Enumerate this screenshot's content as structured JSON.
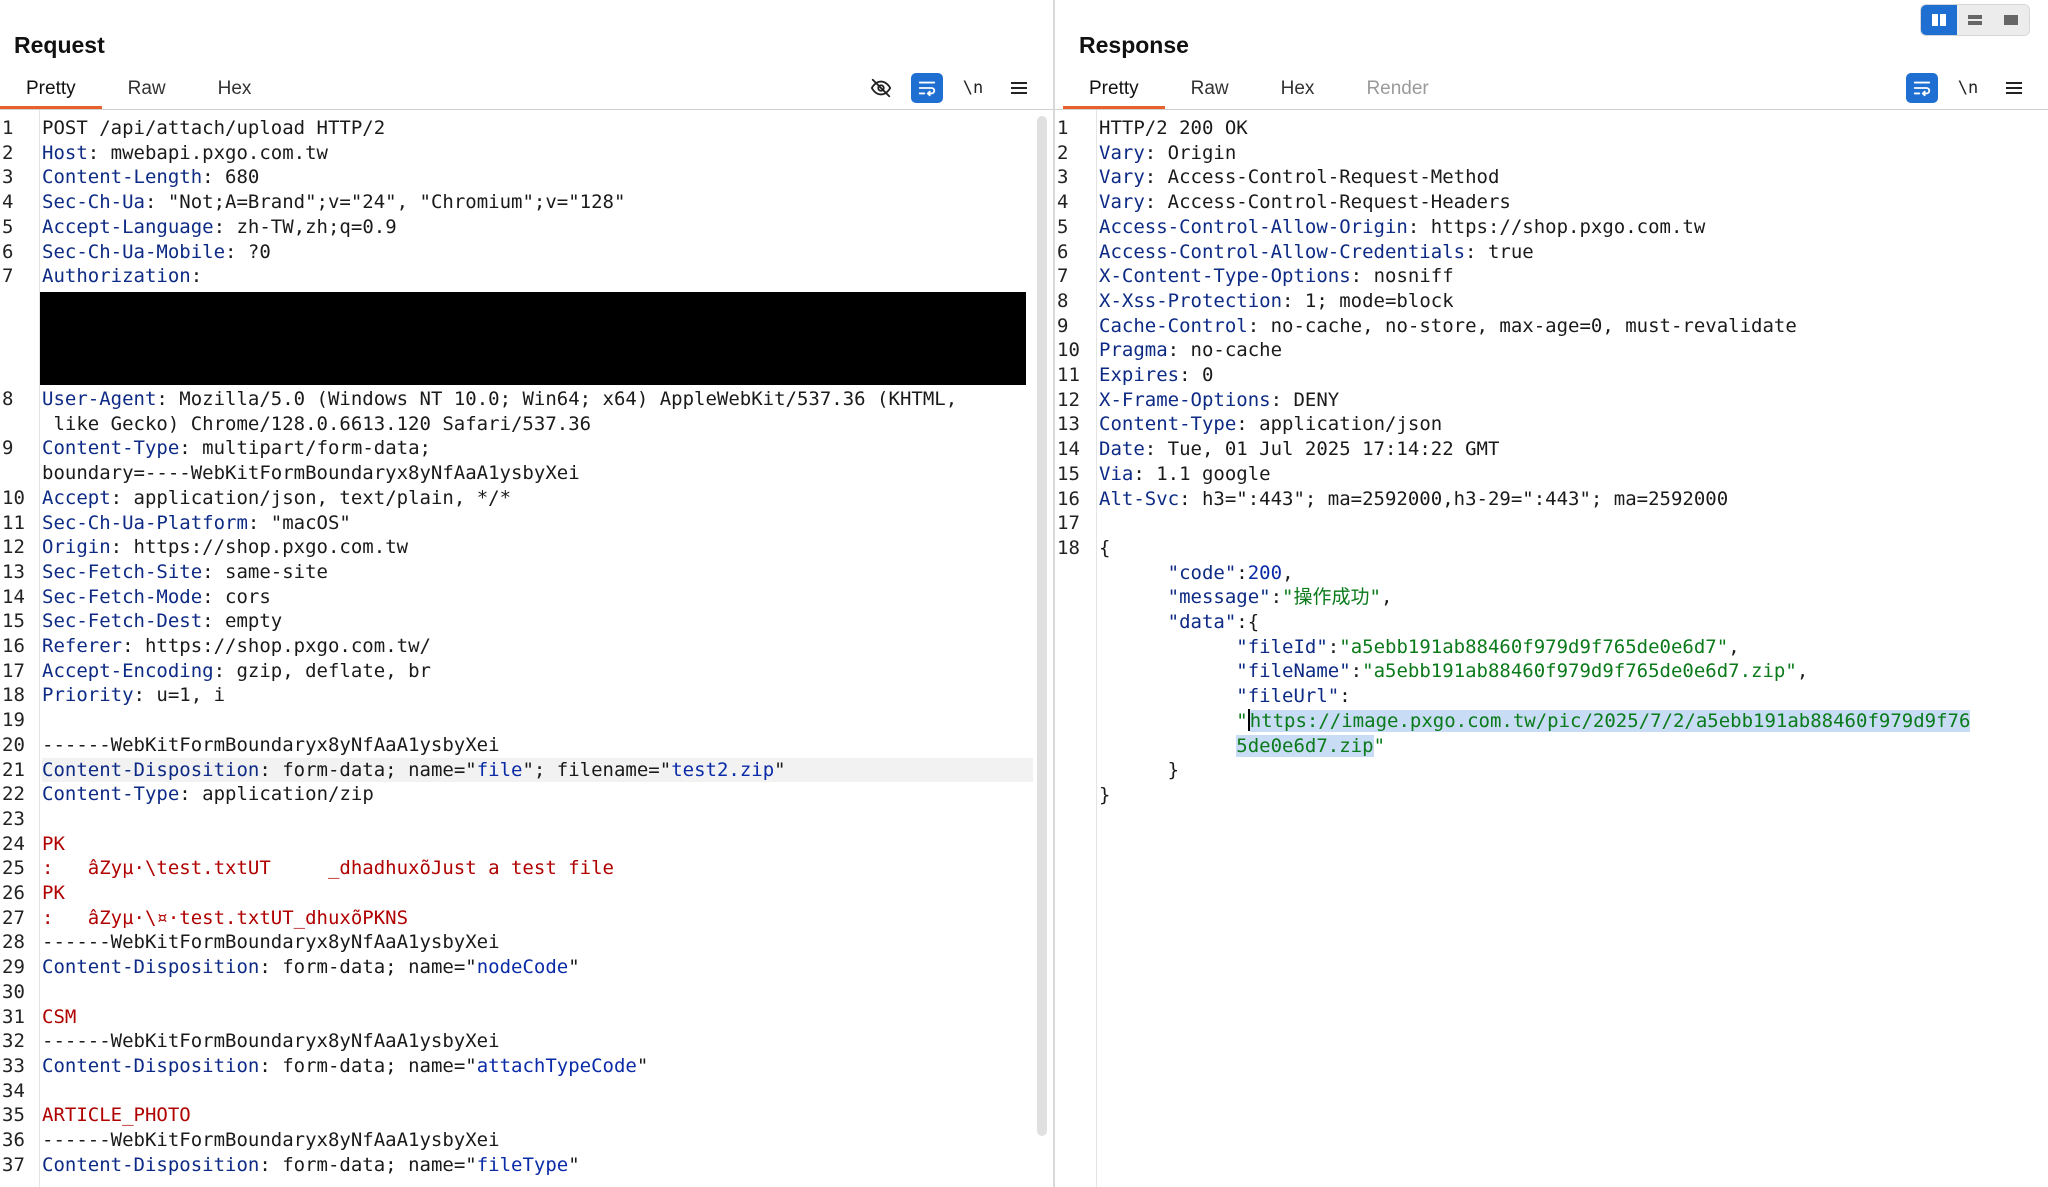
{
  "request": {
    "title": "Request",
    "tabs": [
      "Pretty",
      "Raw",
      "Hex"
    ],
    "active_tab": "Pretty",
    "toolbar": {
      "hide_icon": "eye-off-icon",
      "wrap_icon": "wrap-icon",
      "newline_label": "\\n",
      "menu_icon": "menu-icon"
    },
    "lines": {
      "l1": "POST /api/attach/upload HTTP/2",
      "l2k": "Host",
      "l2v": " mwebapi.pxgo.com.tw",
      "l3k": "Content-Length",
      "l3v": " 680",
      "l4k": "Sec-Ch-Ua",
      "l4v": " \"Not;A=Brand\";v=\"24\", \"Chromium\";v=\"128\"",
      "l5k": "Accept-Language",
      "l5v": " zh-TW,zh;q=0.9",
      "l6k": "Sec-Ch-Ua-Mobile",
      "l6v": " ?0",
      "l7k": "Authorization",
      "l7v": "",
      "l8k": "User-Agent",
      "l8v": " Mozilla/5.0 (Windows NT 10.0; Win64; x64) AppleWebKit/537.36 (KHTML,",
      "l8b": " like Gecko) Chrome/128.0.6613.120 Safari/537.36",
      "l9k": "Content-Type",
      "l9v": " multipart/form-data;",
      "l9b": "boundary=----WebKitFormBoundaryx8yNfAaA1ysbyXei",
      "l10k": "Accept",
      "l10v": " application/json, text/plain, */*",
      "l11k": "Sec-Ch-Ua-Platform",
      "l11v": " \"macOS\"",
      "l12k": "Origin",
      "l12v": " https://shop.pxgo.com.tw",
      "l13k": "Sec-Fetch-Site",
      "l13v": " same-site",
      "l14k": "Sec-Fetch-Mode",
      "l14v": " cors",
      "l15k": "Sec-Fetch-Dest",
      "l15v": " empty",
      "l16k": "Referer",
      "l16v": " https://shop.pxgo.com.tw/",
      "l17k": "Accept-Encoding",
      "l17v": " gzip, deflate, br",
      "l18k": "Priority",
      "l18v": " u=1, i",
      "l20": "------WebKitFormBoundaryx8yNfAaA1ysbyXei",
      "l21k": "Content-Disposition",
      "l21v1": " form-data; name=\"",
      "l21s1": "file",
      "l21v2": "\"; filename=\"",
      "l21s2": "test2.zip",
      "l21v3": "\"",
      "l22k": "Content-Type",
      "l22v": " application/zip",
      "l24": "PK",
      "l25": ":   âZyµ·\\test.txtUT     _dhadhuxõJust a test file",
      "l26": "PK",
      "l27": ":   âZyµ·\\¤·test.txtUT_dhuxõPKNS",
      "l28": "------WebKitFormBoundaryx8yNfAaA1ysbyXei",
      "l29k": "Content-Disposition",
      "l29v1": " form-data; name=\"",
      "l29s": "nodeCode",
      "l29v2": "\"",
      "l31": "CSM",
      "l32": "------WebKitFormBoundaryx8yNfAaA1ysbyXei",
      "l33k": "Content-Disposition",
      "l33v1": " form-data; name=\"",
      "l33s": "attachTypeCode",
      "l33v2": "\"",
      "l35": "ARTICLE_PHOTO",
      "l36": "------WebKitFormBoundaryx8yNfAaA1ysbyXei",
      "l37k": "Content-Disposition",
      "l37v1": " form-data; name=\"",
      "l37s": "fileType",
      "l37v2": "\""
    },
    "line_numbers": [
      "1",
      "2",
      "3",
      "4",
      "5",
      "6",
      "7",
      "8",
      "9",
      "10",
      "11",
      "12",
      "13",
      "14",
      "15",
      "16",
      "17",
      "18",
      "19",
      "20",
      "21",
      "22",
      "23",
      "24",
      "25",
      "26",
      "27",
      "28",
      "29",
      "30",
      "31",
      "32",
      "33",
      "34",
      "35",
      "36",
      "37"
    ]
  },
  "response": {
    "title": "Response",
    "tabs": [
      "Pretty",
      "Raw",
      "Hex",
      "Render"
    ],
    "active_tab": "Pretty",
    "toolbar": {
      "wrap_icon": "wrap-icon",
      "newline_label": "\\n",
      "menu_icon": "menu-icon"
    },
    "view_toggle": [
      "split-columns-icon",
      "split-rows-icon",
      "single-pane-icon"
    ],
    "lines": {
      "l1": "HTTP/2 200 OK",
      "l2k": "Vary",
      "l2v": " Origin",
      "l3k": "Vary",
      "l3v": " Access-Control-Request-Method",
      "l4k": "Vary",
      "l4v": " Access-Control-Request-Headers",
      "l5k": "Access-Control-Allow-Origin",
      "l5v": " https://shop.pxgo.com.tw",
      "l6k": "Access-Control-Allow-Credentials",
      "l6v": " true",
      "l7k": "X-Content-Type-Options",
      "l7v": " nosniff",
      "l8k": "X-Xss-Protection",
      "l8v": " 1; mode=block",
      "l9k": "Cache-Control",
      "l9v": " no-cache, no-store, max-age=0, must-revalidate",
      "l10k": "Pragma",
      "l10v": " no-cache",
      "l11k": "Expires",
      "l11v": " 0",
      "l12k": "X-Frame-Options",
      "l12v": " DENY",
      "l13k": "Content-Type",
      "l13v": " application/json",
      "l14k": "Date",
      "l14v": " Tue, 01 Jul 2025 17:14:22 GMT",
      "l15k": "Via",
      "l15v": " 1.1 google",
      "l16k": "Alt-Svc",
      "l16v": " h3=\":443\"; ma=2592000,h3-29=\":443\"; ma=2592000",
      "l18": "{",
      "j_code_k": "\"code\"",
      "j_code_v": "200",
      "j_msg_k": "\"message\"",
      "j_msg_v": "\"操作成功\"",
      "j_data_k": "\"data\"",
      "j_fileid_k": "\"fileId\"",
      "j_fileid_v": "\"a5ebb191ab88460f979d9f765de0e6d7\"",
      "j_filename_k": "\"fileName\"",
      "j_filename_v": "\"a5ebb191ab88460f979d9f765de0e6d7.zip\"",
      "j_fileurl_k": "\"fileUrl\"",
      "j_fileurl_v1": "https://image.pxgo.com.tw/pic/2025/7/2/a5ebb191ab88460f979d9f76",
      "j_fileurl_v2": "5de0e6d7.zip",
      "close_inner": "}",
      "close_outer": "}"
    },
    "line_numbers": [
      "1",
      "2",
      "3",
      "4",
      "5",
      "6",
      "7",
      "8",
      "9",
      "10",
      "11",
      "12",
      "13",
      "14",
      "15",
      "16",
      "17",
      "18"
    ]
  },
  "colors": {
    "accent_blue": "#1e6fd1",
    "tab_underline": "#e8602c",
    "header_key": "#0d2a85",
    "json_string": "#0a7a1a",
    "body_red": "#b00000"
  }
}
